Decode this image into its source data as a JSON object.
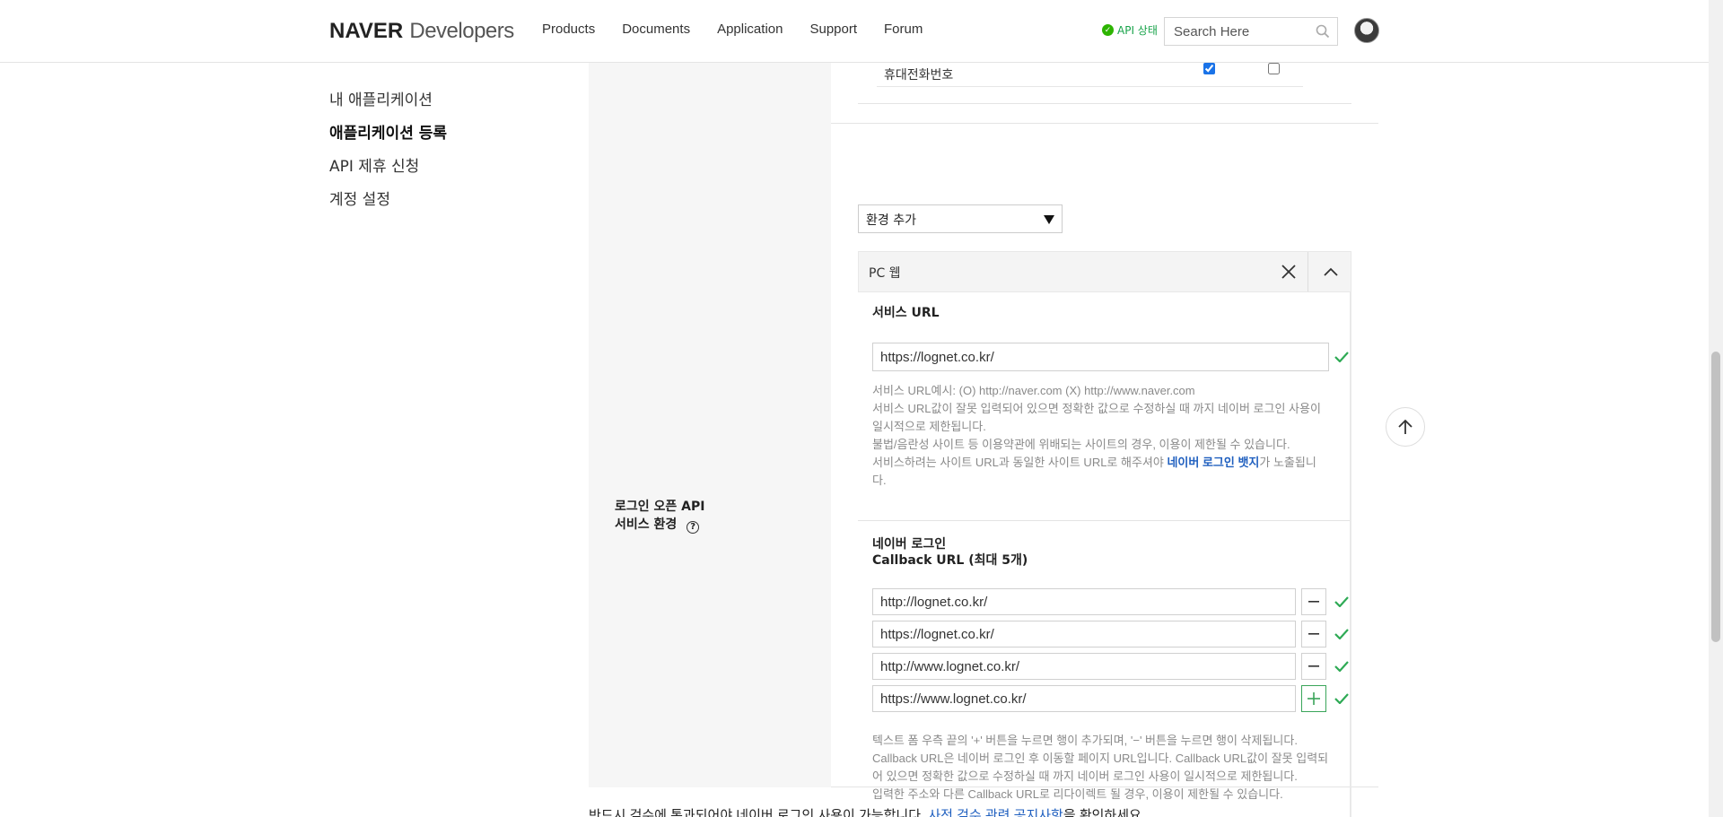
{
  "header": {
    "logo_brand": "NAVER",
    "logo_product": "Developers",
    "nav": [
      "Products",
      "Documents",
      "Application",
      "Support",
      "Forum"
    ],
    "api_status": "API 상태",
    "search_placeholder": "Search Here"
  },
  "sidebar": {
    "items": [
      {
        "label": "내 애플리케이션"
      },
      {
        "label": "애플리케이션 등록"
      },
      {
        "label": "API 제휴 신청"
      },
      {
        "label": "계정 설정"
      }
    ]
  },
  "scope": {
    "item": "휴대전화번호",
    "required_checked": true,
    "optional_checked": false
  },
  "service_env": {
    "label_line1": "로그인 오픈 API",
    "label_line2": "서비스 환경",
    "help": "?",
    "add_env_select": "환경 추가",
    "panel_title": "PC 웹",
    "service_url_title": "서비스 URL",
    "service_url_value": "https://lognet.co.kr/",
    "service_url_notes": {
      "line1": "서비스 URL예시: (O) http://naver.com (X) http://www.naver.com",
      "line2": "서비스 URL값이 잘못 입력되어 있으면 정확한 값으로 수정하실 때 까지 네이버 로그인 사용이 일시적으로 제한됩니다.",
      "line3": "불법/음란성 사이트 등 이용약관에 위배되는 사이트의 경우, 이용이 제한될 수 있습니다.",
      "line4_pre": "서비스하려는 사이트 URL과 동일한 사이트 URL로 해주셔야 ",
      "line4_link": "네이버 로그인 뱃지",
      "line4_post": "가 노출됩니다."
    },
    "callback_title_line1": "네이버 로그인",
    "callback_title_line2": "Callback URL (최대 5개)",
    "callback_urls": [
      "http://lognet.co.kr/",
      "https://lognet.co.kr/",
      "http://www.lognet.co.kr/",
      "https://www.lognet.co.kr/"
    ],
    "minus_label": "−",
    "plus_label": "+",
    "callback_notes": {
      "line1": "텍스트 폼 우측 끝의 '+' 버튼을 누르면 행이 추가되며, '−' 버튼을 누르면 행이 삭제됩니다.",
      "line2": "Callback URL은 네이버 로그인 후 이동할 페이지 URL입니다. Callback URL값이 잘못 입력되어 있으면 정확한 값으로 수정하실 때 까지 네이버 로그인 사용이 일시적으로 제한됩니다.",
      "line3": "입력한 주소와 다른 Callback URL로 리다이렉트 될 경우, 이용이 제한될 수 있습니다."
    }
  },
  "bottom": {
    "pre": "반드시 검수에 통과되어야 네이버 로그인 사용이 가능합니다. ",
    "link": "사전 검수 관련 공지사항",
    "post": "을 확인하세요."
  },
  "colors": {
    "accent_green": "#2db400",
    "link_blue": "#1f5fbf"
  }
}
